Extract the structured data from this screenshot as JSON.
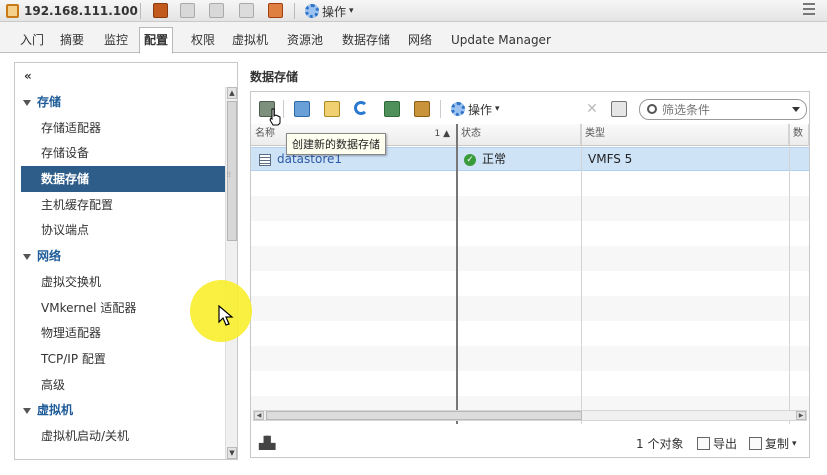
{
  "header": {
    "host": "192.168.111.100",
    "actions_label": "操作",
    "icons": [
      "host-icon",
      "vm-icon",
      "template-icon",
      "power-icon",
      "copy-icon",
      "alarm-icon",
      "gear-icon",
      "menu-icon"
    ]
  },
  "tabs": [
    {
      "label": "入门"
    },
    {
      "label": "摘要"
    },
    {
      "label": "监控"
    },
    {
      "label": "配置",
      "active": true
    },
    {
      "label": "权限"
    },
    {
      "label": "虚拟机"
    },
    {
      "label": "资源池"
    },
    {
      "label": "数据存储"
    },
    {
      "label": "网络"
    },
    {
      "label": "Update Manager"
    }
  ],
  "sidebar": {
    "collapse": "«",
    "items": [
      {
        "label": "存储",
        "type": "section"
      },
      {
        "label": "存储适配器",
        "type": "item"
      },
      {
        "label": "存储设备",
        "type": "item"
      },
      {
        "label": "数据存储",
        "type": "item",
        "selected": true
      },
      {
        "label": "主机缓存配置",
        "type": "item"
      },
      {
        "label": "协议端点",
        "type": "item"
      },
      {
        "label": "网络",
        "type": "section"
      },
      {
        "label": "虚拟交换机",
        "type": "item"
      },
      {
        "label": "VMkernel 适配器",
        "type": "item"
      },
      {
        "label": "物理适配器",
        "type": "item"
      },
      {
        "label": "TCP/IP 配置",
        "type": "item"
      },
      {
        "label": "高级",
        "type": "item"
      },
      {
        "label": "虚拟机",
        "type": "section"
      },
      {
        "label": "虚拟机启动/关机",
        "type": "item"
      }
    ]
  },
  "main": {
    "title": "数据存储",
    "toolbar": {
      "operations_label": "操作",
      "tooltip": "创建新的数据存储",
      "filter_placeholder": "筛选条件"
    },
    "table": {
      "columns": [
        "名称",
        "状态",
        "类型",
        "数据"
      ],
      "sort_indicator": "1 ▲",
      "rows": [
        {
          "name": "datastore1",
          "status": "正常",
          "type": "VMFS 5"
        }
      ]
    },
    "footer": {
      "count": "1 个对象",
      "export_label": "导出",
      "copy_label": "复制"
    }
  },
  "colors": {
    "selected_nav": "#2f5d89",
    "section_text": "#1f5c99",
    "row_selected": "#cfe3f7",
    "status_ok": "#3a9b3a",
    "cursor_highlight": "#f8ee28"
  }
}
